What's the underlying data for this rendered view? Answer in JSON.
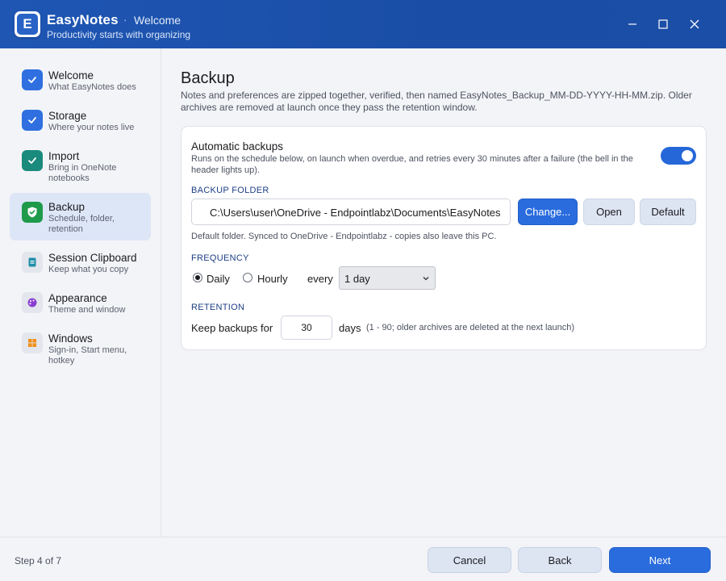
{
  "window": {
    "app_name": "EasyNotes",
    "separator": "·",
    "page": "Welcome",
    "tagline": "Productivity starts with organizing",
    "logo_letter": "E",
    "controls": [
      "minimize-icon",
      "maximize-icon",
      "close-icon"
    ]
  },
  "sidebar": {
    "items": [
      {
        "title": "Welcome",
        "subtitle": "What EasyNotes does",
        "icon": "check-icon",
        "state": "done"
      },
      {
        "title": "Storage",
        "subtitle": "Where your notes live",
        "icon": "check-icon",
        "state": "done"
      },
      {
        "title": "Import",
        "subtitle": "Bring in OneNote notebooks",
        "icon": "check-icon",
        "state": "done"
      },
      {
        "title": "Backup",
        "subtitle": "Schedule, folder, retention",
        "icon": "shield-icon",
        "state": "active"
      },
      {
        "title": "Session Clipboard",
        "subtitle": "Keep what you copy",
        "icon": "clipboard-icon",
        "state": "pending"
      },
      {
        "title": "Appearance",
        "subtitle": "Theme and window",
        "icon": "palette-icon",
        "state": "pending"
      },
      {
        "title": "Windows",
        "subtitle": "Sign-in, Start menu, hotkey",
        "icon": "windows-icon",
        "state": "pending"
      }
    ]
  },
  "main": {
    "title": "Backup",
    "description": "Notes and preferences are zipped together, verified, then named EasyNotes_Backup_MM-DD-YYYY-HH-MM.zip. Older archives are removed at launch once they pass the retention window.",
    "automatic": {
      "title": "Automatic backups",
      "description": "Runs on the schedule below, on launch when overdue, and retries every 30 minutes after a failure (the bell in the header lights up).",
      "enabled": true
    },
    "folder": {
      "label": "BACKUP FOLDER",
      "value": "C:\\Users\\user\\OneDrive - Endpointlabz\\Documents\\EasyNotes",
      "change_label": "Change...",
      "open_label": "Open",
      "default_label": "Default",
      "note": "Default folder. Synced to OneDrive - Endpointlabz - copies also leave this PC."
    },
    "frequency": {
      "label": "FREQUENCY",
      "options": [
        "Daily",
        "Hourly"
      ],
      "selected": "Daily",
      "every_label": "every",
      "interval": "1 day"
    },
    "retention": {
      "label": "RETENTION",
      "keep_label": "Keep backups for",
      "days": "30",
      "days_label": "days",
      "note": "(1 - 90; older archives are deleted at the next launch)"
    }
  },
  "footer": {
    "step": "Step 4 of 7",
    "cancel_label": "Cancel",
    "back_label": "Back",
    "next_label": "Next"
  },
  "colors": {
    "accent": "#2a6cde",
    "titlebar": "#1f56b4",
    "done": "#2f6fe0",
    "active_bg": "#dde6f7"
  }
}
